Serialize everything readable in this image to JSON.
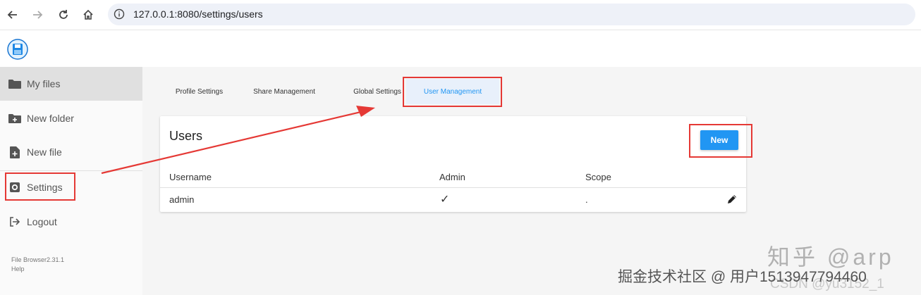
{
  "browser": {
    "url": "127.0.0.1:8080/settings/users"
  },
  "sidebar": {
    "items": [
      {
        "label": "My files",
        "icon": "folder-icon"
      },
      {
        "label": "New folder",
        "icon": "folder-plus-icon"
      },
      {
        "label": "New file",
        "icon": "file-plus-icon"
      },
      {
        "label": "Settings",
        "icon": "gear-icon"
      },
      {
        "label": "Logout",
        "icon": "logout-icon"
      }
    ],
    "footer": {
      "version": "File Browser2.31.1",
      "help": "Help"
    }
  },
  "tabs": [
    {
      "label": "Profile Settings"
    },
    {
      "label": "Share Management"
    },
    {
      "label": "Global Settings"
    },
    {
      "label": "User Management"
    }
  ],
  "users_card": {
    "title": "Users",
    "new_label": "New",
    "columns": [
      "Username",
      "Admin",
      "Scope"
    ],
    "rows": [
      {
        "username": "admin",
        "admin": "✓",
        "scope": "."
      }
    ]
  },
  "watermarks": {
    "zhihu": "知乎 @arp",
    "juejin": "掘金技术社区 @ 用户1513947794460",
    "csdn": "CSDN @yu3152_1"
  },
  "colors": {
    "accent": "#2196f3",
    "annotation": "#e53935"
  }
}
